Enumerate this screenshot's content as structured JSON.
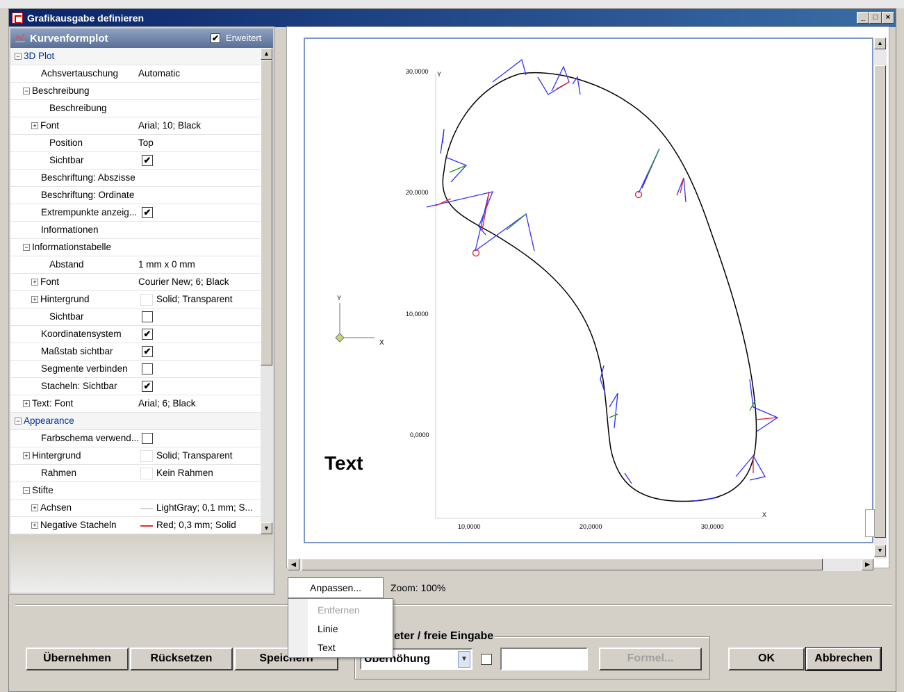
{
  "window": {
    "title": "Grafikausgabe definieren",
    "controls": [
      "_",
      "□",
      "×"
    ]
  },
  "property_grid": {
    "title": "Kurvenformplot",
    "advanced_label": "Erweitert",
    "advanced_checked": true,
    "rows": [
      {
        "name": "3D Plot",
        "kind": "category"
      },
      {
        "name": "Achsvertauschung",
        "value": "Automatic"
      },
      {
        "name": "Beschreibung",
        "kind": "group"
      },
      {
        "name": "Beschreibung",
        "value": ""
      },
      {
        "name": "Font",
        "value": "Arial; 10; Black",
        "expandable": true
      },
      {
        "name": "Position",
        "value": "Top"
      },
      {
        "name": "Sichtbar",
        "checkbox": true
      },
      {
        "name": "Beschriftung: Abszisse",
        "value": ""
      },
      {
        "name": "Beschriftung: Ordinate",
        "value": ""
      },
      {
        "name": "Extrempunkte anzeig...",
        "checkbox": true
      },
      {
        "name": "Informationen",
        "value": ""
      },
      {
        "name": "Informationstabelle",
        "kind": "group"
      },
      {
        "name": "Abstand",
        "value": "1 mm x 0 mm"
      },
      {
        "name": "Font",
        "value": "Courier New; 6; Black",
        "expandable": true
      },
      {
        "name": "Hintergrund",
        "value": "Solid; Transparent",
        "expandable": true,
        "swatch": "#ffffff"
      },
      {
        "name": "Sichtbar",
        "checkbox": false
      },
      {
        "name": "Koordinatensystem",
        "checkbox": true
      },
      {
        "name": "Maßstab sichtbar",
        "checkbox": true
      },
      {
        "name": "Segmente verbinden",
        "checkbox": false
      },
      {
        "name": "Stacheln: Sichtbar",
        "checkbox": true
      },
      {
        "name": "Text: Font",
        "value": "Arial; 6; Black",
        "expandable": true
      },
      {
        "name": "Appearance",
        "kind": "category"
      },
      {
        "name": "Farbschema verwend...",
        "checkbox": false
      },
      {
        "name": "Hintergrund",
        "value": "Solid; Transparent",
        "expandable": true,
        "swatch": "#ffffff"
      },
      {
        "name": "Rahmen",
        "value": "Kein Rahmen",
        "swatch": "#ffffff"
      },
      {
        "name": "Stifte",
        "kind": "group"
      },
      {
        "name": "Achsen",
        "value": "LightGray; 0,1 mm; S...",
        "expandable": true,
        "line": "#d3d3d3"
      },
      {
        "name": "Negative Stacheln",
        "value": "Red; 0,3 mm; Solid",
        "expandable": true,
        "line": "#e03030"
      }
    ]
  },
  "plot": {
    "text_label": "Text",
    "axis_x_label": "X",
    "axis_y_label": "Y",
    "ucs_x": "X",
    "ucs_y": "Y",
    "x_ticks": [
      "10,0000",
      "20,0000",
      "30,0000"
    ],
    "y_ticks": [
      "30,0000",
      "20,0000",
      "10,0000",
      "0,0000"
    ]
  },
  "controls": {
    "anpassen": "Anpassen...",
    "zoom": "Zoom: 100%",
    "menu": [
      "Entfernen",
      "Linie",
      "Text"
    ],
    "group_title": "eter / freie Eingabe",
    "combo_value": "Überhöhung",
    "formel": "Formel...",
    "buttons": {
      "ubernehmen": "Übernehmen",
      "rucksetzen": "Rücksetzen",
      "speichern": "Speichern",
      "ok": "OK",
      "abbrechen": "Abbrechen"
    }
  },
  "colors": {
    "curve": "#000000",
    "spikes_blue": "#3030ff",
    "spikes_red": "#e02020",
    "spikes_green": "#209020",
    "title_bar": "#0a246a"
  }
}
